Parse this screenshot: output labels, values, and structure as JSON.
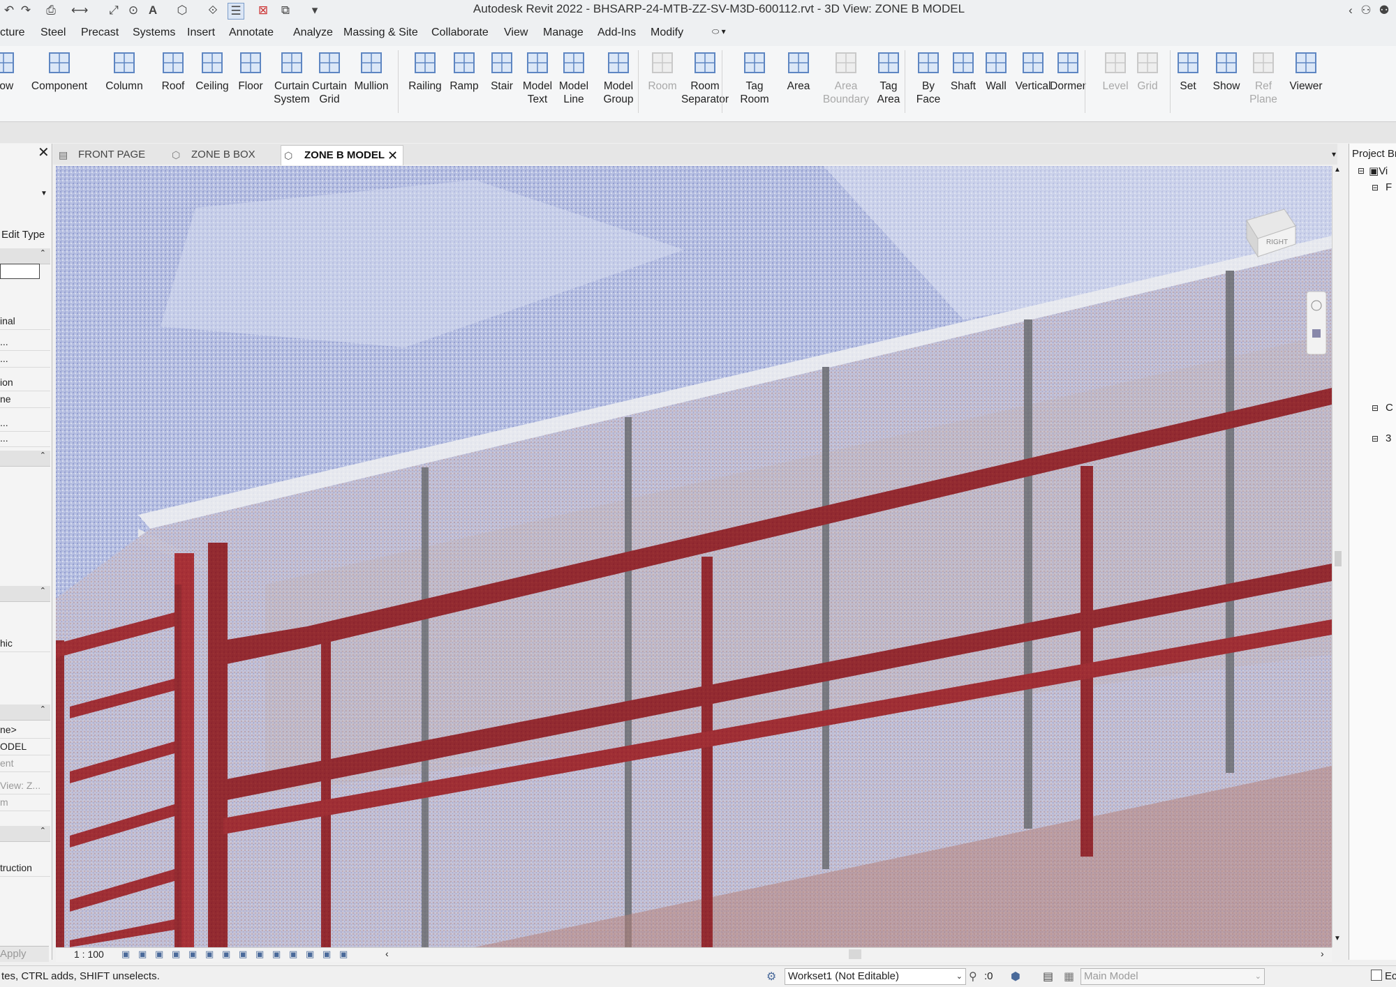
{
  "titlebar": {
    "title": "Autodesk Revit 2022 - BHSARP-24-MTB-ZZ-SV-M3D-600112.rvt - 3D View: ZONE B MODEL"
  },
  "menu": [
    "cture",
    "Steel",
    "Precast",
    "Systems",
    "Insert",
    "Annotate",
    "Analyze",
    "Massing & Site",
    "Collaborate",
    "View",
    "Manage",
    "Add-Ins",
    "Modify"
  ],
  "ribbon": {
    "buttons": [
      {
        "label": "dow",
        "icon": "window-icon"
      },
      {
        "label": "Component",
        "icon": "component-icon"
      },
      {
        "label": "Column",
        "icon": "column-icon"
      },
      {
        "label": "Roof",
        "icon": "roof-icon"
      },
      {
        "label": "Ceiling",
        "icon": "ceiling-icon"
      },
      {
        "label": "Floor",
        "icon": "floor-icon"
      },
      {
        "label": "Curtain\nSystem",
        "icon": "curtain-system-icon"
      },
      {
        "label": "Curtain\nGrid",
        "icon": "curtain-grid-icon"
      },
      {
        "label": "Mullion",
        "icon": "mullion-icon"
      },
      {
        "label": "Railing",
        "icon": "railing-icon"
      },
      {
        "label": "Ramp",
        "icon": "ramp-icon"
      },
      {
        "label": "Stair",
        "icon": "stair-icon"
      },
      {
        "label": "Model\nText",
        "icon": "model-text-icon"
      },
      {
        "label": "Model\nLine",
        "icon": "model-line-icon"
      },
      {
        "label": "Model\nGroup",
        "icon": "model-group-icon"
      },
      {
        "label": "Room",
        "icon": "room-icon",
        "disabled": true
      },
      {
        "label": "Room\nSeparator",
        "icon": "room-separator-icon"
      },
      {
        "label": "Tag\nRoom",
        "icon": "tag-room-icon"
      },
      {
        "label": "Area",
        "icon": "area-icon"
      },
      {
        "label": "Area\nBoundary",
        "icon": "area-boundary-icon",
        "disabled": true
      },
      {
        "label": "Tag\nArea",
        "icon": "tag-area-icon"
      },
      {
        "label": "By\nFace",
        "icon": "by-face-icon"
      },
      {
        "label": "Shaft",
        "icon": "shaft-icon"
      },
      {
        "label": "Wall",
        "icon": "wall-opening-icon"
      },
      {
        "label": "Vertical",
        "icon": "vertical-opening-icon"
      },
      {
        "label": "Dormer",
        "icon": "dormer-icon"
      },
      {
        "label": "Level",
        "icon": "level-icon",
        "disabled": true
      },
      {
        "label": "Grid",
        "icon": "grid-icon",
        "disabled": true
      },
      {
        "label": "Set",
        "icon": "set-workplane-icon"
      },
      {
        "label": "Show",
        "icon": "show-workplane-icon"
      },
      {
        "label": "Ref\nPlane",
        "icon": "ref-plane-icon",
        "disabled": true
      },
      {
        "label": "Viewer",
        "icon": "viewer-icon"
      }
    ]
  },
  "tabs": [
    {
      "label": "FRONT PAGE",
      "icon": "sheet-icon"
    },
    {
      "label": "ZONE B BOX",
      "icon": "3d-view-icon"
    },
    {
      "label": "ZONE B MODEL",
      "icon": "3d-view-icon",
      "active": true
    }
  ],
  "properties": {
    "edit_type": "Edit Type",
    "rows": [
      "inal",
      "...",
      "...",
      "ion",
      "ne",
      "...",
      "...",
      "hic",
      "ne>",
      "ODEL",
      "ent",
      "View: Z...",
      "m",
      "truction"
    ],
    "apply": "Apply"
  },
  "project_browser": {
    "title": "Project Br",
    "items": [
      "Vi",
      "F",
      "C",
      "3"
    ]
  },
  "viewcube": {
    "face": "RIGHT"
  },
  "view_control": {
    "scale": "1 : 100"
  },
  "status": {
    "hint": "tes, CTRL adds, SHIFT unselects.",
    "workset": "Workset1 (Not Editable)",
    "selection_count": ":0",
    "design_option": "Main Model",
    "editable_label": "Ec"
  },
  "colors": {
    "steel": "#8b0a0a",
    "cloud_blue": "#b6bedf",
    "accent_tab": "#ffffff"
  }
}
